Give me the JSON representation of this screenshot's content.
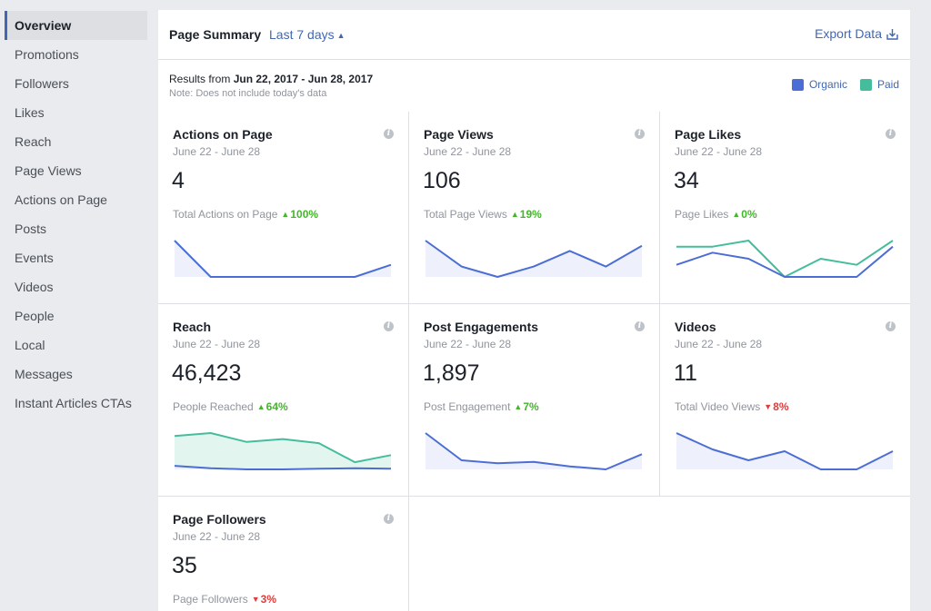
{
  "sidebar": {
    "items": [
      {
        "label": "Overview",
        "active": true
      },
      {
        "label": "Promotions"
      },
      {
        "label": "Followers"
      },
      {
        "label": "Likes"
      },
      {
        "label": "Reach"
      },
      {
        "label": "Page Views"
      },
      {
        "label": "Actions on Page"
      },
      {
        "label": "Posts"
      },
      {
        "label": "Events"
      },
      {
        "label": "Videos"
      },
      {
        "label": "People"
      },
      {
        "label": "Local"
      },
      {
        "label": "Messages"
      },
      {
        "label": "Instant Articles CTAs"
      }
    ]
  },
  "header": {
    "title": "Page Summary",
    "range": "Last 7 days",
    "export_label": "Export Data"
  },
  "results": {
    "prefix": "Results from",
    "range": "Jun 22, 2017 - Jun 28, 2017",
    "note": "Note: Does not include today's data"
  },
  "legend": {
    "organic": "Organic",
    "paid": "Paid"
  },
  "colors": {
    "organic": "#4c6ed4",
    "paid": "#45bd9d",
    "up": "#42b72a",
    "down": "#e23b3b",
    "link": "#4267b2"
  },
  "cards": [
    {
      "title": "Actions on Page",
      "date": "June 22 - June 28",
      "value": "4",
      "sub": "Total Actions on Page",
      "change": "100%",
      "direction": "up",
      "chart_data": {
        "type": "area",
        "series": [
          {
            "values": [
              3,
              0,
              0,
              0,
              0,
              0,
              1
            ]
          }
        ]
      }
    },
    {
      "title": "Page Views",
      "date": "June 22 - June 28",
      "value": "106",
      "sub": "Total Page Views",
      "change": "19%",
      "direction": "up",
      "chart_data": {
        "type": "area",
        "series": [
          {
            "values": [
              17,
              12,
              10,
              12,
              15,
              12,
              16
            ]
          }
        ]
      }
    },
    {
      "title": "Page Likes",
      "date": "June 22 - June 28",
      "value": "34",
      "sub": "Page Likes",
      "change": "0%",
      "direction": "up",
      "chart_data": {
        "type": "line",
        "series": [
          {
            "values": [
              3,
              5,
              4,
              1,
              1,
              1,
              6
            ]
          },
          {
            "values": [
              6,
              6,
              7,
              1,
              4,
              3,
              7
            ]
          }
        ]
      }
    },
    {
      "title": "Reach",
      "date": "June 22 - June 28",
      "value": "46,423",
      "sub": "People Reached",
      "change": "64%",
      "direction": "up",
      "chart_data": {
        "type": "area",
        "series": [
          {
            "values": [
              1,
              0.6,
              0.4,
              0.4,
              0.5,
              0.6,
              0.5
            ]
          },
          {
            "values": [
              6,
              6.5,
              5,
              5.5,
              4.8,
              1.6,
              2.8
            ]
          }
        ]
      }
    },
    {
      "title": "Post Engagements",
      "date": "June 22 - June 28",
      "value": "1,897",
      "sub": "Post Engagement",
      "change": "7%",
      "direction": "up",
      "chart_data": {
        "type": "area",
        "series": [
          {
            "values": [
              350,
              260,
              250,
              255,
              240,
              230,
              280
            ]
          }
        ]
      }
    },
    {
      "title": "Videos",
      "date": "June 22 - June 28",
      "value": "11",
      "sub": "Total Video Views",
      "change": "8%",
      "direction": "down",
      "chart_data": {
        "type": "area",
        "series": [
          {
            "values": [
              4,
              2.2,
              1,
              2,
              0,
              0,
              2
            ]
          }
        ]
      }
    },
    {
      "title": "Page Followers",
      "date": "June 22 - June 28",
      "value": "35",
      "sub": "Page Followers",
      "change": "3%",
      "direction": "down"
    }
  ]
}
